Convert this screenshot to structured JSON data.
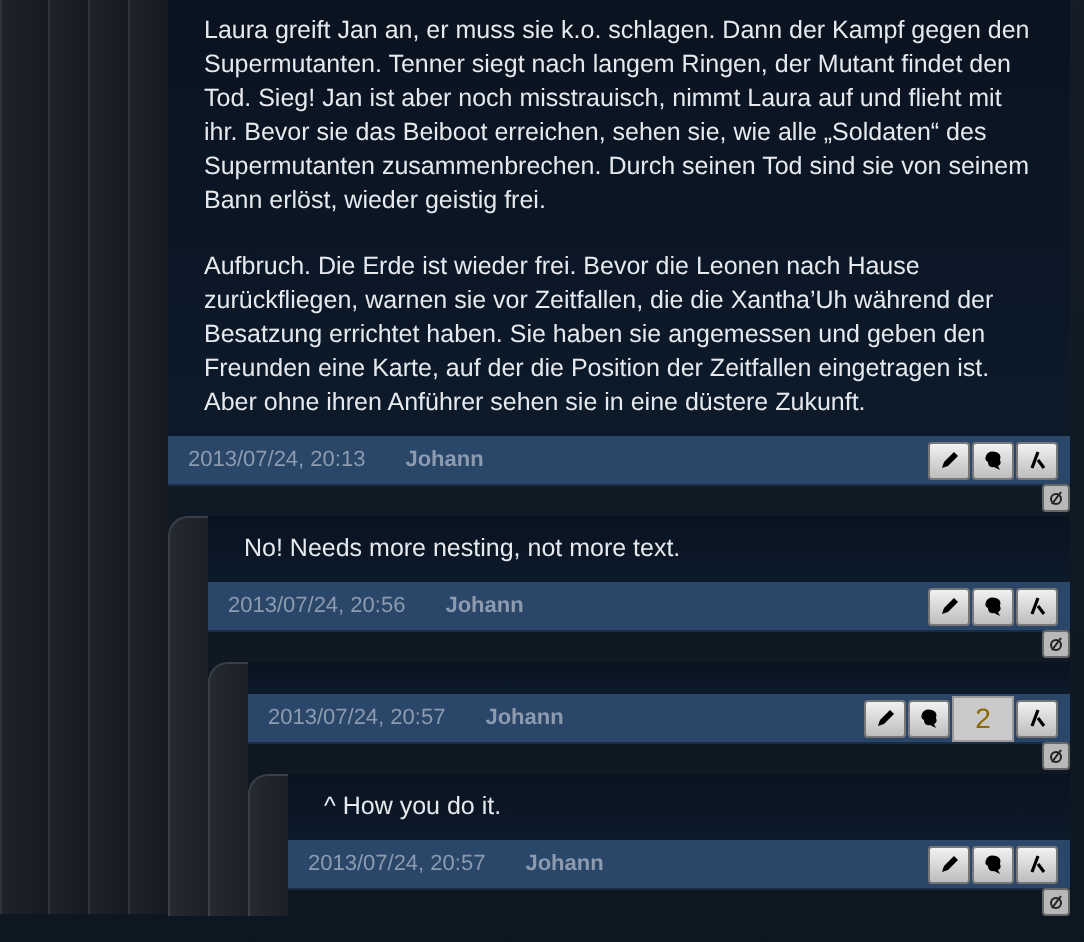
{
  "comments": [
    {
      "paragraphs": [
        "Laura greift Jan an, er muss sie k.o. schlagen. Dann der Kampf gegen den Supermutanten. Tenner siegt nach langem Ringen, der Mutant findet den Tod. Sieg! Jan ist aber noch misstrauisch, nimmt Laura auf und flieht mit ihr. Bevor sie das Beiboot erreichen, sehen sie, wie alle „Soldaten“ des Supermutanten zusammenbrechen. Durch seinen Tod sind sie von seinem Bann erlöst, wieder geistig frei.",
        "Aufbruch. Die Erde ist wieder frei. Bevor die Leonen nach Hause zurückfliegen, warnen sie vor Zeitfallen, die die Xantha’Uh während der Besatzung errichtet haben. Sie haben sie angemessen und geben den Freunden eine Karte, auf der die Position der Zeitfallen eingetragen ist. Aber ohne ihren Anführer sehen sie in eine düstere Zukunft."
      ],
      "date": "2013/07/24, 20:13",
      "author": "Johann",
      "children": [
        {
          "paragraphs": [
            "No! Needs more nesting, not more text."
          ],
          "date": "2013/07/24, 20:56",
          "author": "Johann",
          "children": [
            {
              "date": "2013/07/24, 20:57",
              "author": "Johann",
              "count": "2",
              "children": [
                {
                  "paragraphs": [
                    "^ How you do it."
                  ],
                  "date": "2013/07/24, 20:57",
                  "author": "Johann"
                }
              ]
            }
          ]
        }
      ]
    }
  ]
}
